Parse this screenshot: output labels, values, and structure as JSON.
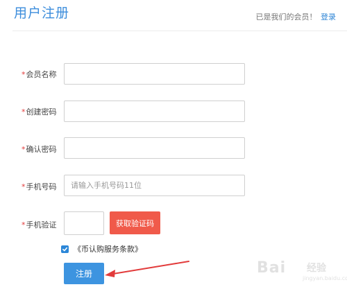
{
  "header": {
    "title": "用户注册",
    "member_note": "已是我们的会员！",
    "login_link": "登录"
  },
  "form": {
    "required_mark": "*",
    "fields": [
      {
        "label": "会员名称",
        "value": "",
        "placeholder": ""
      },
      {
        "label": "创建密码",
        "value": "",
        "placeholder": ""
      },
      {
        "label": "确认密码",
        "value": "",
        "placeholder": ""
      },
      {
        "label": "手机号码",
        "value": "",
        "placeholder": "请输入手机号码11位"
      },
      {
        "label": "手机验证",
        "value": "",
        "placeholder": ""
      }
    ],
    "get_code_button": "获取验证码",
    "agreement": {
      "checked": true,
      "text": "《币认购服务条款》"
    },
    "submit_button": "注册"
  },
  "colors": {
    "primary": "#3d94e0",
    "title": "#3c8ddc",
    "required": "#e23b3b",
    "code_button": "#f05a4a",
    "annotation_arrow": "#e23b3b"
  },
  "watermark": {
    "logo": "Bai",
    "sub": "经验",
    "url": "jingyan.baidu.com"
  }
}
